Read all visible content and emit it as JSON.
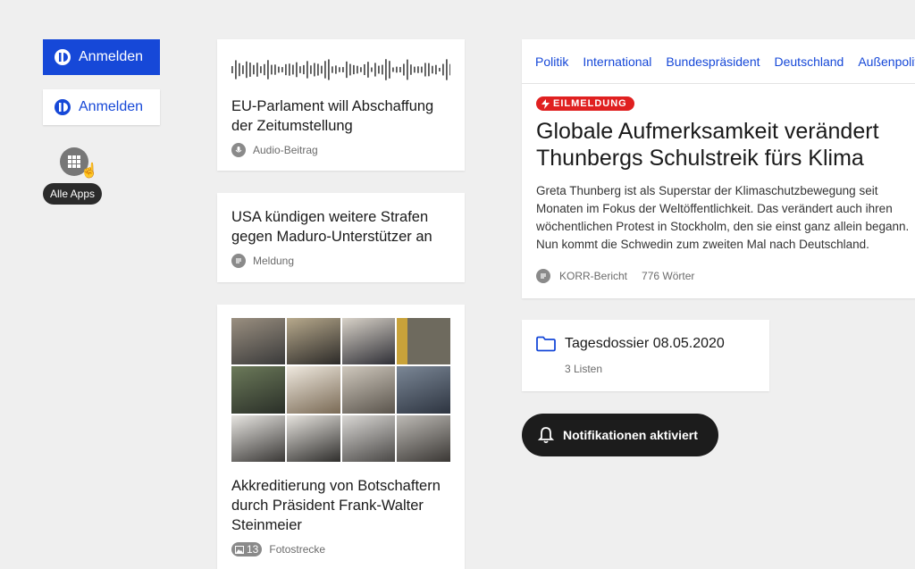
{
  "login": {
    "label_filled": "Anmelden",
    "label_outline": "Anmelden"
  },
  "apps": {
    "tooltip": "Alle Apps"
  },
  "audio_card": {
    "title": "EU-Parlament will Abschaffung der Zeitumstellung",
    "meta": "Audio-Beitrag",
    "icon": "microphone-icon"
  },
  "usa_card": {
    "title": "USA kündigen weitere Strafen gegen Maduro-Unterstützer an",
    "meta": "Meldung",
    "icon": "document-icon"
  },
  "photo_card": {
    "title": "Akkreditierung von Botschaftern durch Präsident Frank-Walter Steinmeier",
    "count": "13",
    "meta": "Fotostrecke",
    "icon": "image-icon"
  },
  "nav": {
    "items": [
      "Politik",
      "International",
      "Bundespräsident",
      "Deutschland",
      "Außenpolitik"
    ]
  },
  "main": {
    "badge": "EILMELDUNG",
    "title": "Globale Aufmerksamkeit verändert Thunbergs Schulstreik fürs Klima",
    "teaser": "Greta Thunberg ist als Superstar der Klimaschutzbewegung seit Monaten im Fokus der Weltöffentlichkeit. Das verändert auch ihren wöchentlichen Protest in Stockholm, den sie einst ganz allein begann. Nun kommt die Schwedin zum zweiten Mal nach Deutschland.",
    "meta_type": "KORR-Bericht",
    "meta_words": "776 Wörter"
  },
  "dossier": {
    "title": "Tagesdossier 08.05.2020",
    "sub": "3 Listen"
  },
  "toast": {
    "label": "Notifikationen aktiviert"
  },
  "colors": {
    "accent": "#1648d8",
    "breaking": "#e02020",
    "toast": "#1c1c1c",
    "background": "#efefef"
  }
}
